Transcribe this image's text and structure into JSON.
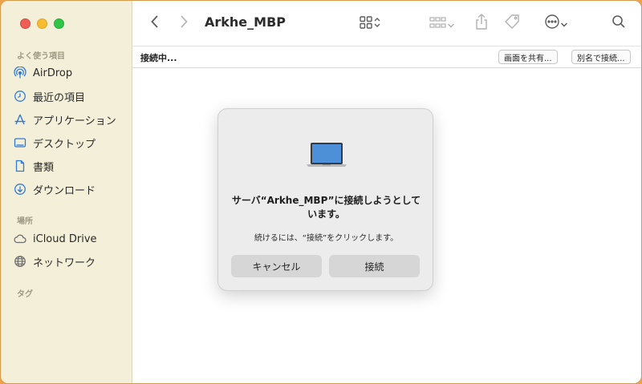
{
  "window": {
    "title": "Arkhe_MBP"
  },
  "sidebar": {
    "favorites_title": "よく使う項目",
    "favorites": [
      {
        "label": "AirDrop",
        "icon": "airdrop-icon"
      },
      {
        "label": "最近の項目",
        "icon": "clock-icon"
      },
      {
        "label": "アプリケーション",
        "icon": "applications-icon"
      },
      {
        "label": "デスクトップ",
        "icon": "desktop-icon"
      },
      {
        "label": "書類",
        "icon": "document-icon"
      },
      {
        "label": "ダウンロード",
        "icon": "download-icon"
      }
    ],
    "locations_title": "場所",
    "locations": [
      {
        "label": "iCloud Drive",
        "icon": "cloud-icon"
      },
      {
        "label": "ネットワーク",
        "icon": "network-globe-icon"
      }
    ],
    "tags_title": "タグ"
  },
  "status": {
    "text": "接続中...",
    "share_screen_label": "画面を共有...",
    "connect_as_label": "別名で接続..."
  },
  "dialog": {
    "title": "サーバ“Arkhe_MBP”に接続しようとしています。",
    "message": "続けるには、“接続”をクリックします。",
    "cancel_label": "キャンセル",
    "connect_label": "接続"
  },
  "colors": {
    "accent": "#2f7ad6",
    "sidebar_bg": "#f4efd9",
    "desktop_bg": "#f0a24a"
  }
}
